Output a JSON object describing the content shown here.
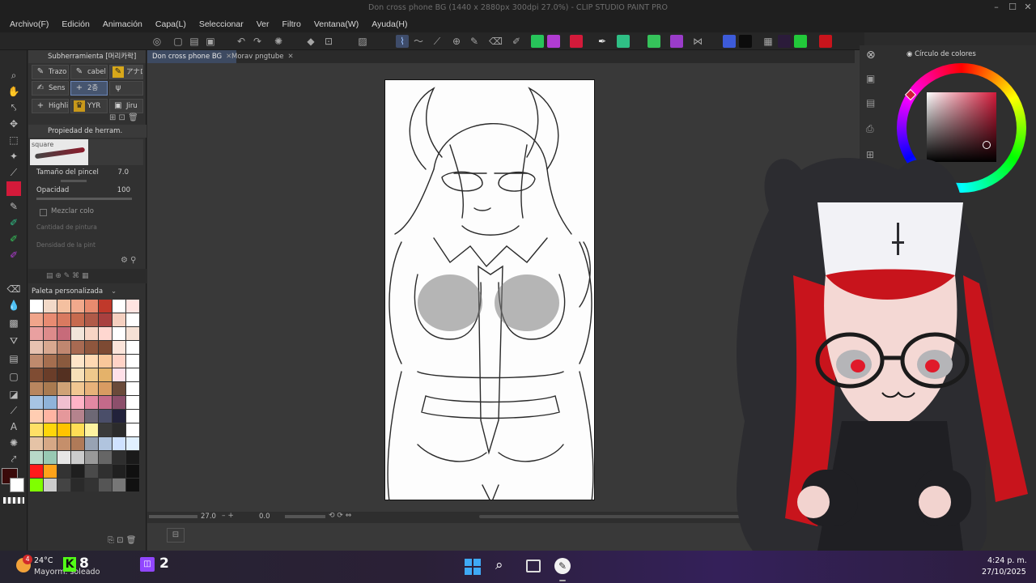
{
  "window": {
    "title": "Don cross phone BG (1440 x 2880px 300dpi 27.0%) - CLIP STUDIO PAINT PRO"
  },
  "menu": [
    "Archivo(F)",
    "Edición",
    "Animación",
    "Capa(L)",
    "Seleccionar",
    "Ver",
    "Filtro",
    "Ventana(W)",
    "Ayuda(H)"
  ],
  "subtool": {
    "header": "Subherramienta [머리카락]",
    "row1": [
      "Trazo",
      "cabel",
      "アナロ"
    ],
    "row2": [
      "Sens",
      "2층",
      ""
    ],
    "row3": [
      "Highli",
      "YYR",
      "Jiru"
    ]
  },
  "props": {
    "header": "Propiedad de herram. [squar",
    "brush_name": "square",
    "size_label": "Tamaño del pincel",
    "size_value": "7.0",
    "opacity_label": "Opacidad",
    "opacity_value": "100",
    "blend_label": "Mezclar colo",
    "paint_amount_label": "Cantidad de pintura",
    "paint_density_label": "Densidad de la pint"
  },
  "palette": {
    "header": "Paleta personalizada"
  },
  "tabs": [
    {
      "label": "Don cross phone BG",
      "active": true
    },
    {
      "label": "Morav pngtube",
      "active": false
    }
  ],
  "status": {
    "zoom": "27.0",
    "angle": "0.0"
  },
  "color_panel": {
    "title": "Círculo de colores",
    "current_color": "#d31a3a"
  },
  "taskbar": {
    "weather_temp": "24°C",
    "weather_desc": "Mayorm. soleado",
    "weather_badge": "4",
    "kick_count": "8",
    "twitch_count": "2",
    "time": "4:24 p. m.",
    "date": "27/10/2025"
  },
  "swatches": [
    "#ffffff",
    "#f2d9c8",
    "#f4c0a0",
    "#f1a98c",
    "#e88a6e",
    "#c0392b",
    "#ffffff",
    "#ffe4e1",
    "#f0a58b",
    "#e88b72",
    "#d97a60",
    "#c76a4e",
    "#b05a48",
    "#a8403f",
    "#f5d0c0",
    "#ffffff",
    "#e9a0a0",
    "#dd8b8b",
    "#c76b7a",
    "#f2e5da",
    "#f7d5c5",
    "#ffd7d0",
    "#ffffff",
    "#f5e1d5",
    "#e7c2b0",
    "#d8a890",
    "#c08770",
    "#a86a52",
    "#8f563d",
    "#7d4a33",
    "#fbe4da",
    "#ffffff",
    "#bf8a6d",
    "#a56e4f",
    "#8a5a3e",
    "#ffe6c9",
    "#ffd9b3",
    "#f9c79a",
    "#ffd3c7",
    "#ffffff",
    "#7f4c33",
    "#6a3d29",
    "#543021",
    "#f7e0b8",
    "#efc98c",
    "#e4b26a",
    "#ffe0e8",
    "#ffffff",
    "#b9865f",
    "#a97a50",
    "#cfa276",
    "#f1c792",
    "#e8b27a",
    "#d89b62",
    "#6a4a3a",
    "#ffffff",
    "#a7c4e4",
    "#8fb3d9",
    "#f0c0d0",
    "#ffb3c7",
    "#e389a3",
    "#c46a8a",
    "#8c4f6b",
    "#ffffff",
    "#ffcdb2",
    "#ffb4a2",
    "#e5989b",
    "#b5838d",
    "#6d6875",
    "#4a4e69",
    "#22223b",
    "#ffffff",
    "#ffe066",
    "#ffd60a",
    "#ffc300",
    "#ffdd55",
    "#fef3a0",
    "#3a3a3a",
    "#2b2b2b",
    "#ffffff",
    "#e5c3a6",
    "#d6a886",
    "#c58f6b",
    "#b07a58",
    "#98a3b3",
    "#b0c4de",
    "#cfe2ff",
    "#e0f0ff",
    "#b8d8c8",
    "#98c9b3",
    "#e6e6e6",
    "#cccccc",
    "#999999",
    "#666666",
    "#2e2e2e",
    "#1a1a1a",
    "#ff1a1a",
    "#ffa31a",
    "#333333",
    "#1f1f1f",
    "#4a4a4a",
    "#303030",
    "#202020",
    "#101010",
    "#7fff00",
    "#cccccc",
    "#444444",
    "#2a2a2a",
    "#333333",
    "#555555",
    "#777777",
    "#111111"
  ]
}
